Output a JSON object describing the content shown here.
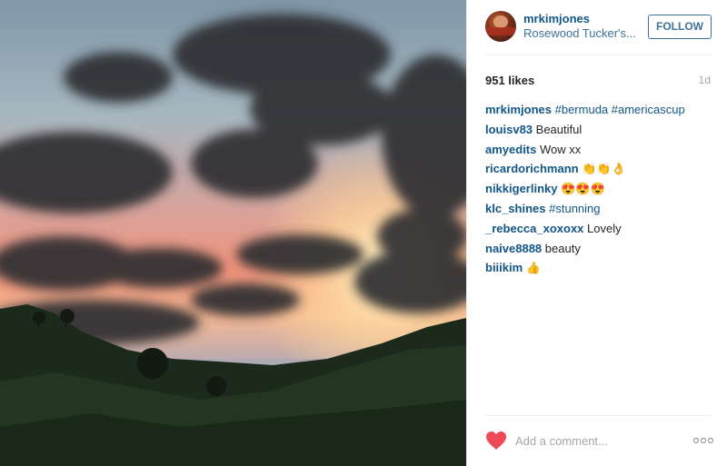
{
  "post": {
    "username": "mrkimjones",
    "location": "Rosewood Tucker's...",
    "follow_label": "FOLLOW",
    "likes": "951 likes",
    "age": "1d"
  },
  "comments": [
    {
      "user": "mrkimjones",
      "text": "#bermuda #americascup"
    },
    {
      "user": "louisv83",
      "text": "Beautiful"
    },
    {
      "user": "amyedits",
      "text": "Wow xx"
    },
    {
      "user": "ricardorichmann",
      "text": "👏👏👌"
    },
    {
      "user": "nikkigerlinky",
      "text": "😍😍😍"
    },
    {
      "user": "klc_shines",
      "text": "#stunning"
    },
    {
      "user": "_rebecca_xoxoxx",
      "text": "Lovely"
    },
    {
      "user": "naive8888",
      "text": "beauty"
    },
    {
      "user": "biiikim",
      "text": "👍"
    }
  ],
  "footer": {
    "comment_placeholder": "Add a comment...",
    "heart_icon": "heart-icon",
    "more_icon": "more-options-icon"
  },
  "colors": {
    "accent": "#3f729b",
    "username": "#125688",
    "heart": "#ed4956"
  }
}
